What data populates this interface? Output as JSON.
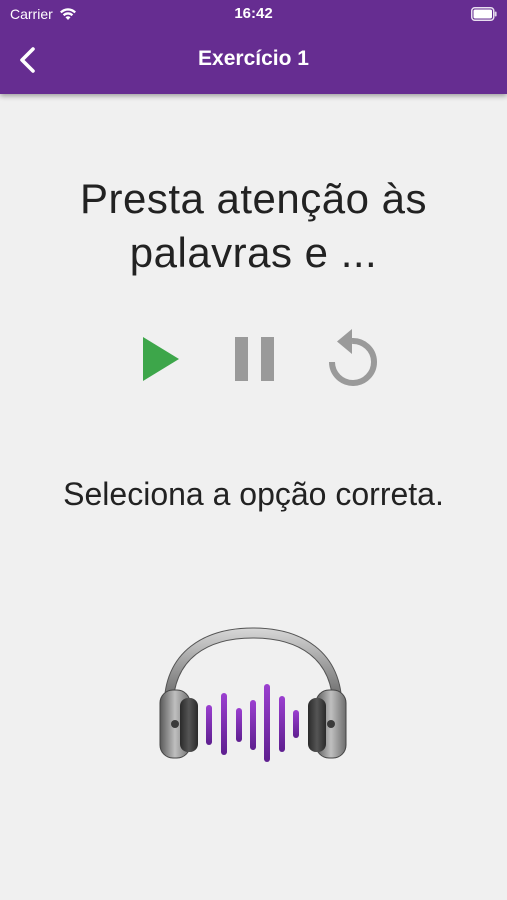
{
  "status_bar": {
    "carrier": "Carrier",
    "time": "16:42",
    "wifi_icon": "wifi-icon",
    "battery_icon": "battery-icon"
  },
  "nav": {
    "title": "Exercício 1",
    "back_icon": "chevron-left-icon"
  },
  "content": {
    "prompt": "Presta atenção às palavras e ...",
    "instruction": "Seleciona a opção correta."
  },
  "controls": {
    "play_icon": "play-icon",
    "pause_icon": "pause-icon",
    "replay_icon": "replay-icon"
  },
  "illustration": {
    "icon": "headphones-audio-icon"
  },
  "colors": {
    "header": "#662d91",
    "background": "#f0f0f0",
    "play": "#3da64a",
    "pause": "#9a9a9a",
    "replay": "#9a9a9a",
    "wave": "#7b2fa8"
  }
}
